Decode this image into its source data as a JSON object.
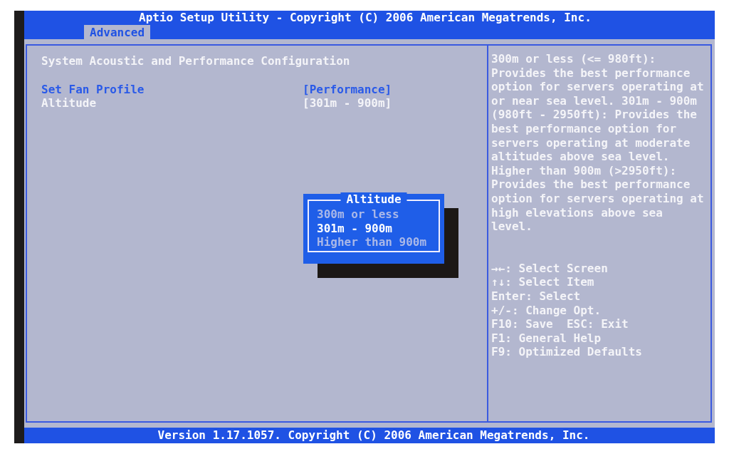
{
  "title": "Aptio Setup Utility - Copyright (C) 2006 American Megatrends, Inc.",
  "tabs": [
    {
      "label": "Advanced",
      "selected": true
    }
  ],
  "section_title": "System Acoustic and Performance Configuration",
  "settings": [
    {
      "label": "Set Fan Profile",
      "value": "[Performance]",
      "selected": true
    },
    {
      "label": "Altitude",
      "value": "[301m - 900m]",
      "selected": false
    }
  ],
  "popup": {
    "title": "Altitude",
    "options": [
      {
        "label": "300m or less",
        "selected": false
      },
      {
        "label": "301m - 900m",
        "selected": true
      },
      {
        "label": "Higher than 900m",
        "selected": false
      }
    ]
  },
  "help_text": [
    "300m or less (<= 980ft):",
    "Provides the best performance",
    "option for servers operating at",
    "or near sea level. 301m - 900m",
    "(980ft - 2950ft): Provides the",
    "best performance option for",
    "servers operating at moderate",
    "altitudes above sea level.",
    "Higher than 900m (>2950ft):",
    "Provides the best performance",
    "option for servers operating at",
    "high elevations above sea",
    "level."
  ],
  "key_help": [
    "→←: Select Screen",
    "↑↓: Select Item",
    "Enter: Select",
    "+/-: Change Opt.",
    "F10: Save  ESC: Exit",
    "F1: General Help",
    "F9: Optimized Defaults"
  ],
  "footer": "Version 1.17.1057. Copyright (C) 2006 American Megatrends, Inc."
}
